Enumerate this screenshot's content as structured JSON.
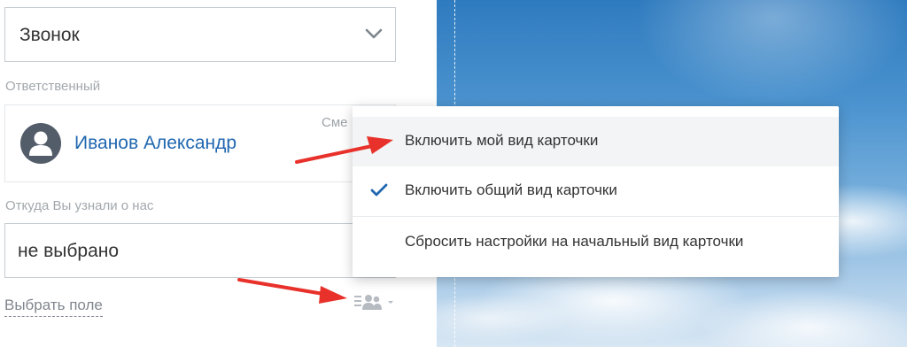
{
  "form": {
    "type_select": {
      "value": "Звонок"
    },
    "responsible": {
      "label": "Ответственный",
      "name": "Иванов Александр",
      "change_link": "Сме"
    },
    "source": {
      "label": "Откуда Вы узнали о нас",
      "value": "не выбрано"
    },
    "choose_field_link": "Выбрать поле"
  },
  "dropdown": {
    "items": [
      {
        "label": "Включить мой вид карточки",
        "checked": false,
        "hovered": true
      },
      {
        "label": "Включить общий вид карточки",
        "checked": true,
        "hovered": false
      },
      {
        "label": "Сбросить настройки на начальный вид карточки",
        "checked": false,
        "hovered": false
      }
    ]
  },
  "colors": {
    "link_blue": "#2067b0",
    "check_blue": "#2067b0",
    "arrow_red": "#e8312a",
    "label_gray": "#a2a8ad"
  },
  "icons": {
    "select_chevron": "chevron-down-icon",
    "avatar": "user-avatar-icon",
    "check": "checkmark-icon",
    "settings": "users-settings-icon"
  }
}
